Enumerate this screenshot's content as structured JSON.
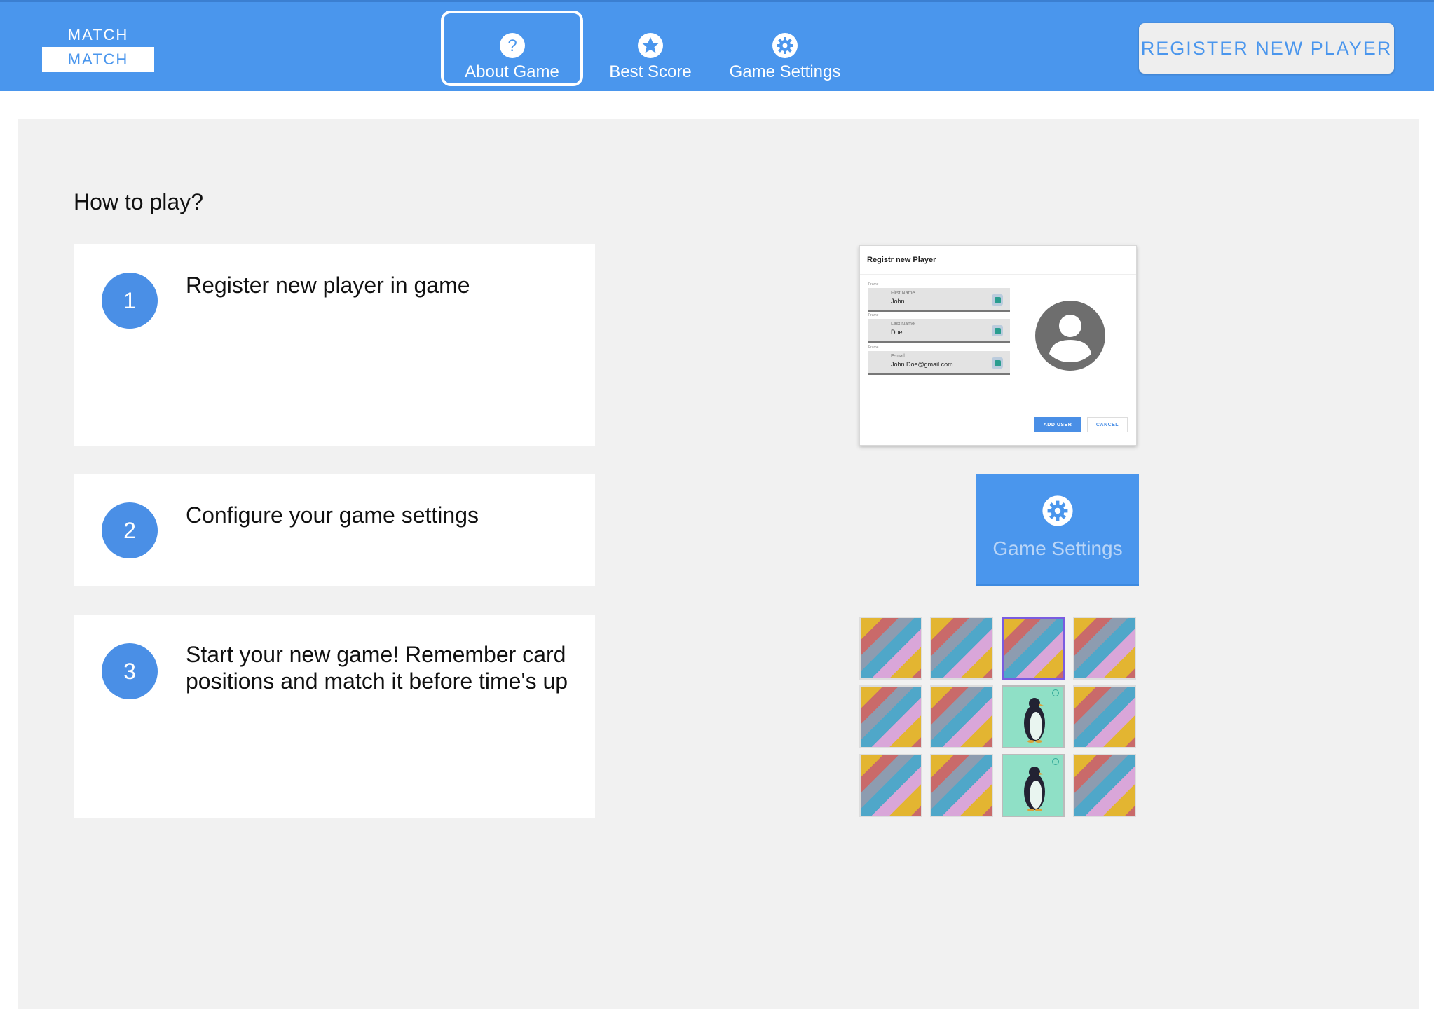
{
  "header": {
    "logo_top": "MATCH",
    "logo_bottom": "MATCH",
    "nav": [
      {
        "label": "About Game",
        "icon": "help-circle-icon",
        "active": true
      },
      {
        "label": "Best Score",
        "icon": "star-icon",
        "active": false
      },
      {
        "label": "Game Settings",
        "icon": "gear-icon",
        "active": false
      }
    ],
    "register_label": "REGISTER NEW PLAYER"
  },
  "main": {
    "title": "How to play?",
    "steps": [
      {
        "number": "1",
        "text": "Register new player in game"
      },
      {
        "number": "2",
        "text": "Configure your game settings"
      },
      {
        "number": "3",
        "text": "Start your new game! Remember card positions and match it before time's up"
      }
    ]
  },
  "preview_dialog": {
    "title": "Registr new Player",
    "fields": [
      {
        "tag": "Frame",
        "label": "First Name",
        "value": "John"
      },
      {
        "tag": "Frame",
        "label": "Last Name",
        "value": "Doe"
      },
      {
        "tag": "Frame",
        "label": "E-mail",
        "value": "John.Doe@gmail.com"
      }
    ],
    "add_label": "ADD USER",
    "cancel_label": "CANCEL",
    "avatar_icon": "account-circle-icon"
  },
  "preview_settings": {
    "label": "Game Settings",
    "icon": "gear-icon"
  },
  "preview_cards": {
    "rows": 3,
    "cols": 4,
    "matched_positions": [
      [
        1,
        2
      ],
      [
        2,
        2
      ]
    ],
    "selected_positions": [
      [
        0,
        2
      ]
    ]
  },
  "colors": {
    "primary": "#4a96ed",
    "panel_bg": "#f1f1f1",
    "step_circle": "#4a8fe6"
  }
}
